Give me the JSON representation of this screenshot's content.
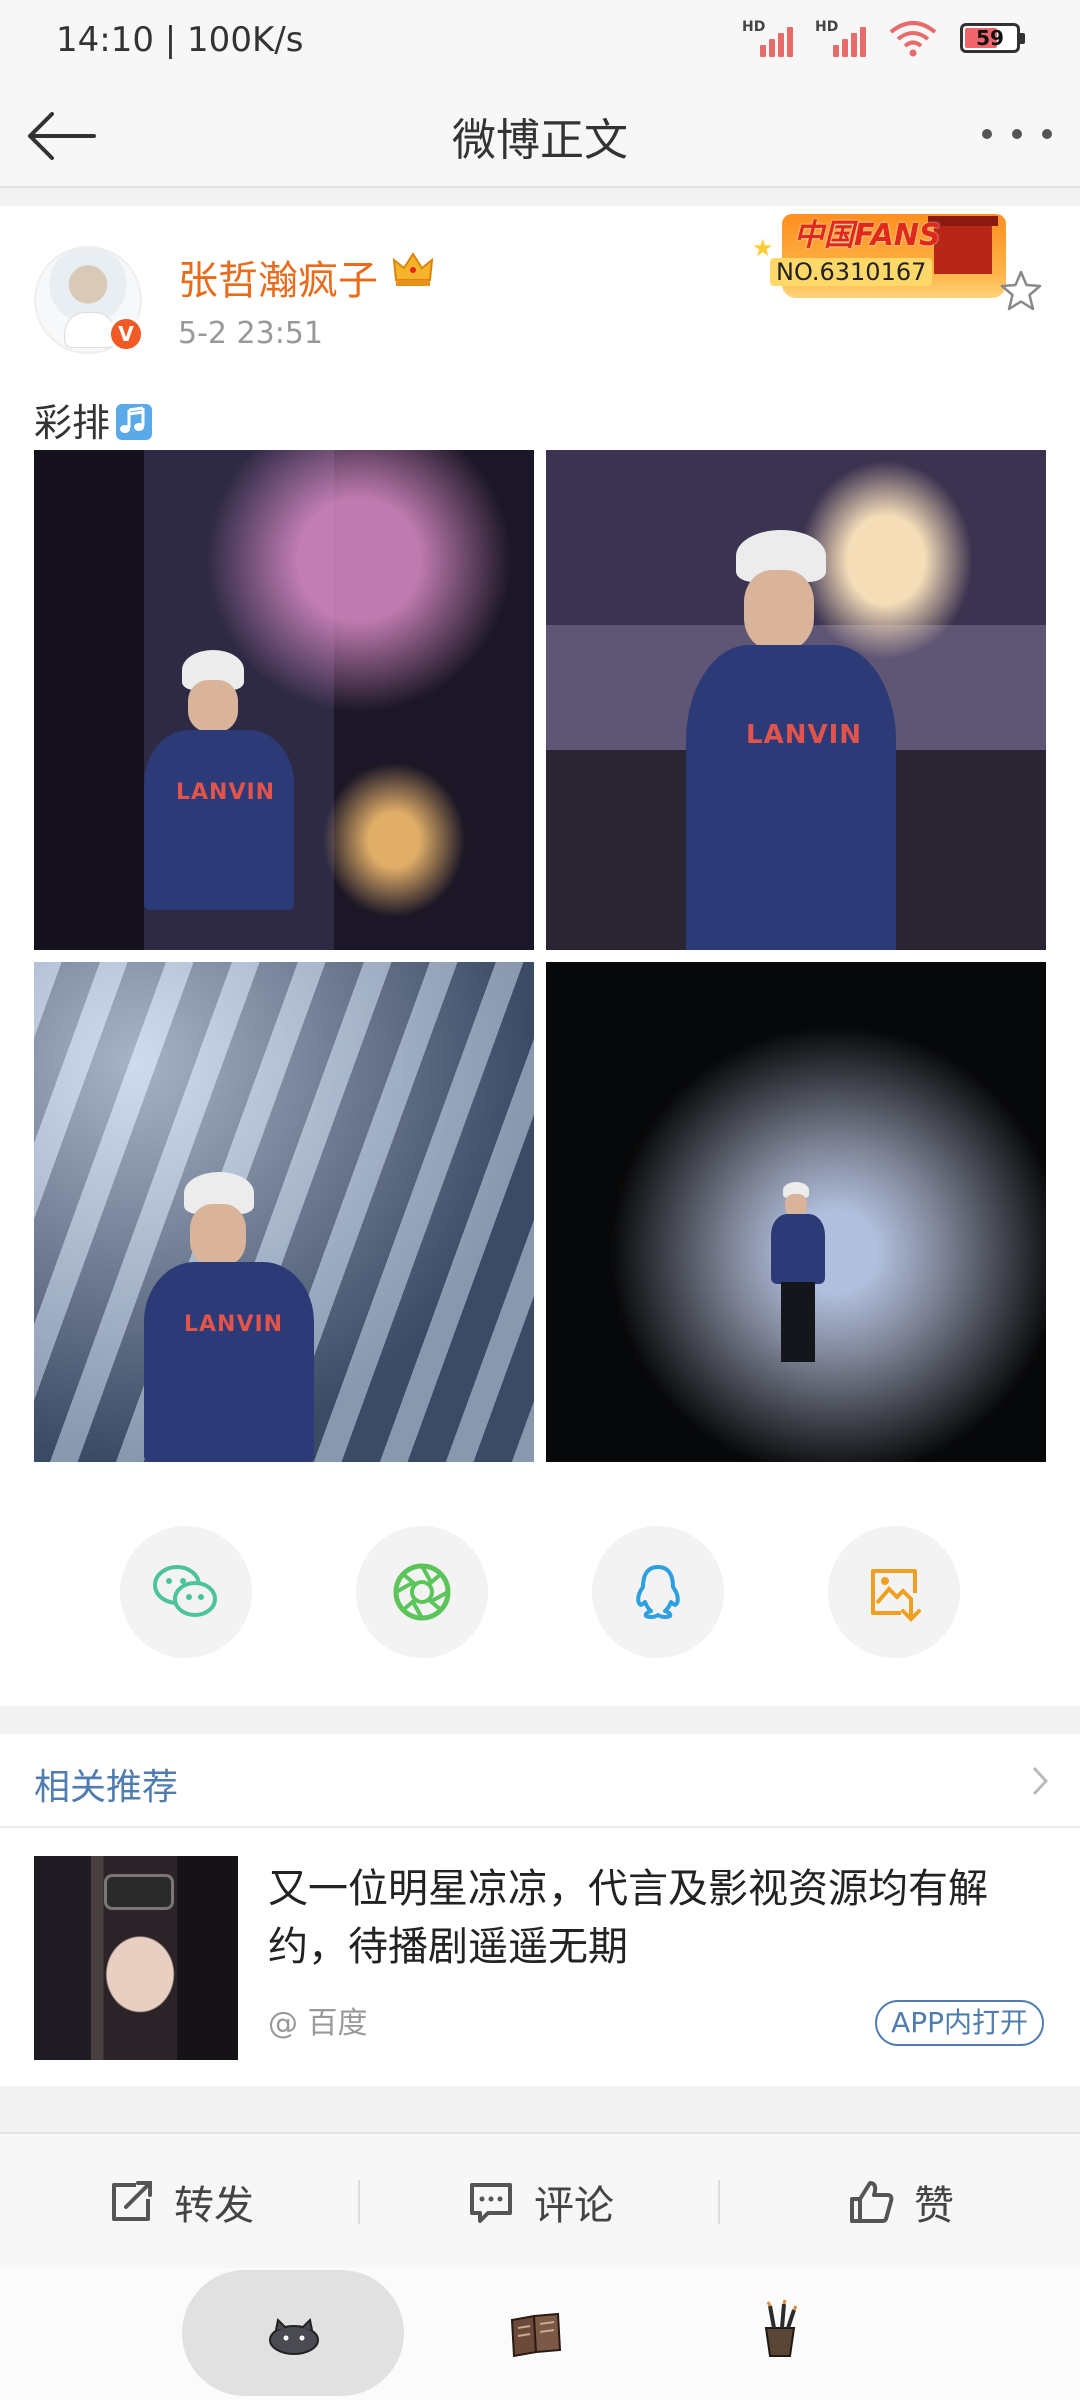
{
  "status_bar": {
    "time_speed": "14:10 | 100K/s",
    "battery": "59"
  },
  "nav": {
    "title": "微博正文"
  },
  "post": {
    "username": "张哲瀚疯子",
    "time": "5-2 23:51",
    "text": "彩排",
    "fans_badge": {
      "label": "中国FANS",
      "number": "NO.6310167"
    },
    "photos": [
      "rehearsal-photo-1",
      "rehearsal-photo-2",
      "rehearsal-photo-3",
      "rehearsal-photo-4"
    ],
    "share_targets": [
      "wechat-icon",
      "moments-icon",
      "qq-icon",
      "save-image-icon"
    ]
  },
  "related": {
    "title": "相关推荐",
    "item": {
      "headline": "又一位明星凉凉，代言及影视资源均有解约，待播剧遥遥无期",
      "source": "@ 百度",
      "open_label": "APP内打开"
    }
  },
  "actions": {
    "repost": "转发",
    "comment": "评论",
    "like": "赞"
  },
  "colors": {
    "username": "#e86c1c",
    "link_blue": "#507daf",
    "verified": "#f15a24"
  }
}
